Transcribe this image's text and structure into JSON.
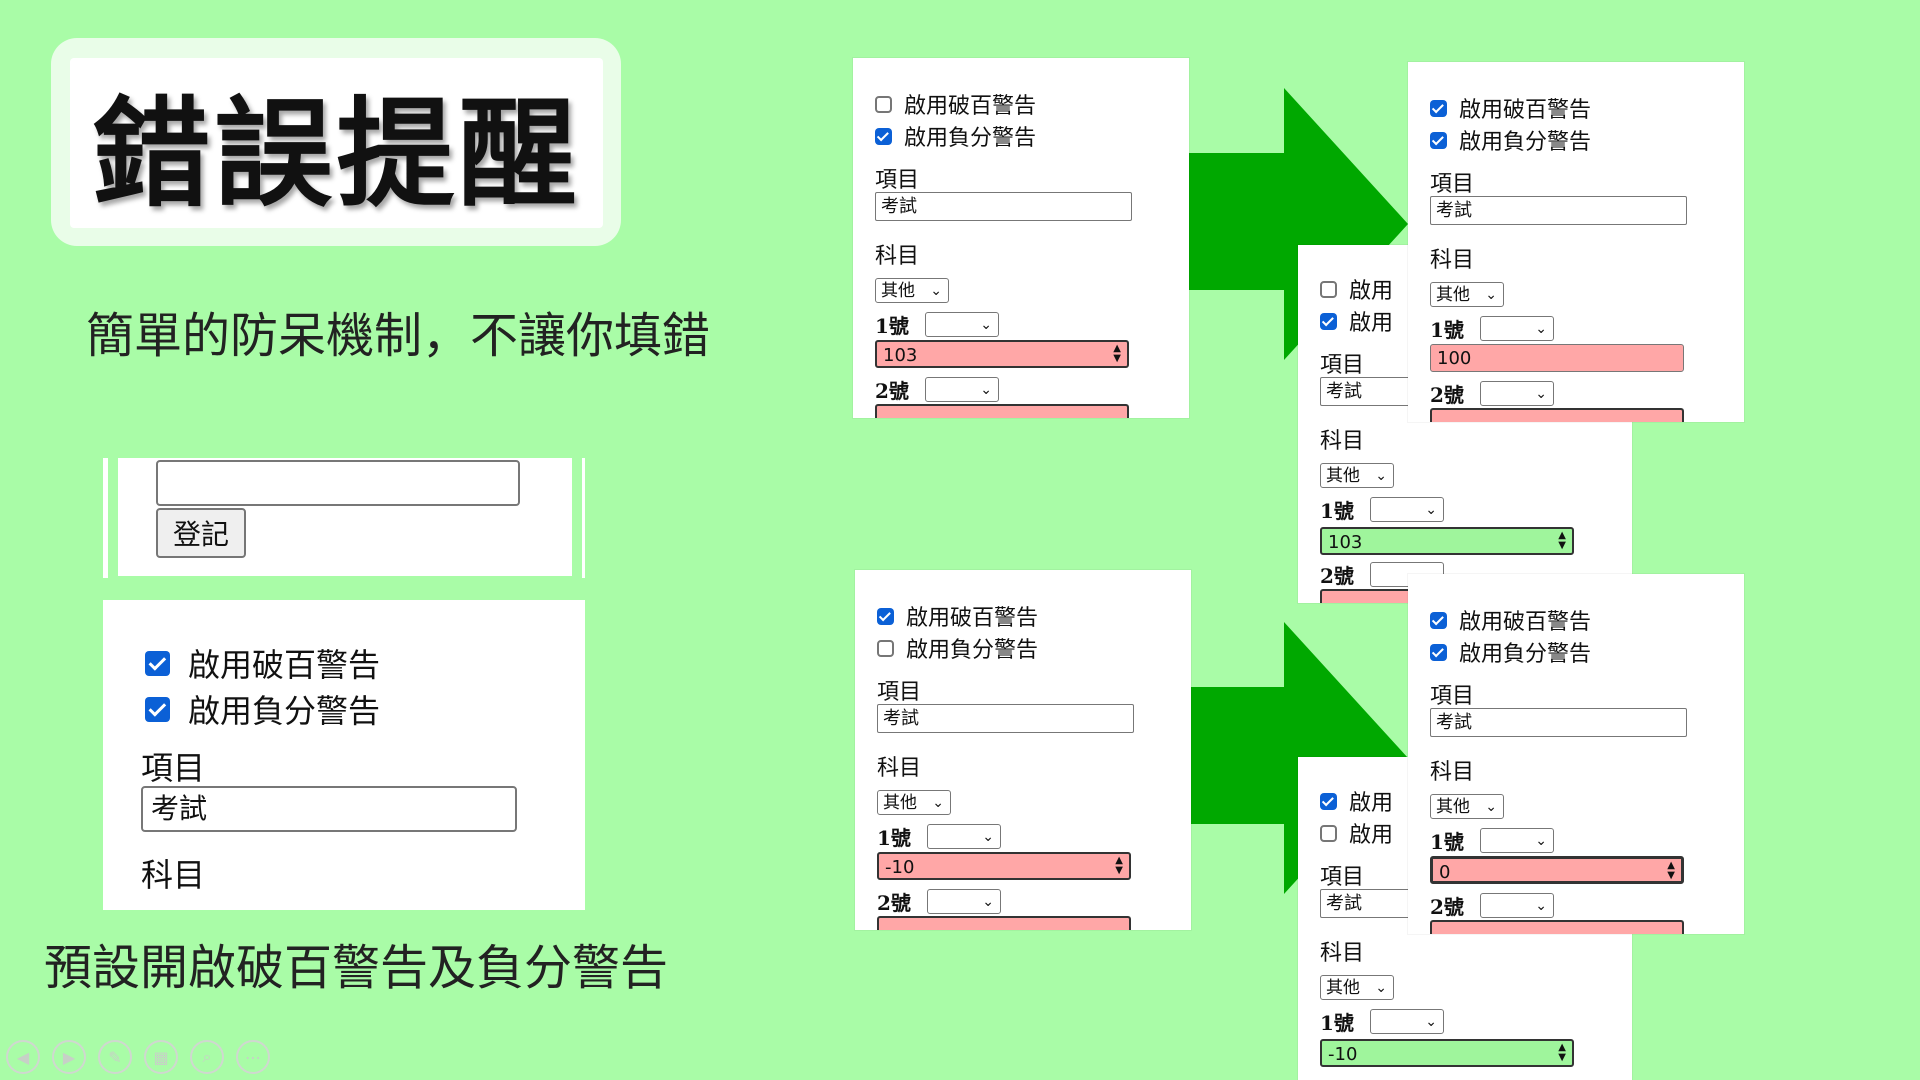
{
  "title": "錯誤提醒",
  "subtitle": "簡單的防呆機制，不讓你填錯",
  "caption": "預設開啟破百警告及負分警告",
  "zoom": {
    "register_button": "登記",
    "checkbox_100": "啟用破百警告",
    "checkbox_negative": "啟用負分警告",
    "item_label": "項目",
    "item_value": "考試",
    "subject_label": "科目"
  },
  "forms": {
    "chk100": "啟用破百警告",
    "chkneg": "啟用負分警告",
    "chk_short": "啟用",
    "item_label": "項目",
    "item_value": "考試",
    "subject_label": "科目",
    "subject_value": "其他",
    "no1": "1號",
    "no2": "2號",
    "a1_value": "103",
    "a2_value": "100",
    "a3_value": "103",
    "b1_value": "-10",
    "b2_value": "0",
    "b3_value": "-10"
  },
  "colors": {
    "background": "#a9fca7",
    "error": "#ffa7a7",
    "ok": "#9ff59c",
    "arrow": "#00a800",
    "checkbox": "#0b60d6"
  },
  "toolbar_icons": [
    "prev-icon",
    "next-icon",
    "pen-icon",
    "slides-icon",
    "zoom-icon",
    "more-icon"
  ]
}
